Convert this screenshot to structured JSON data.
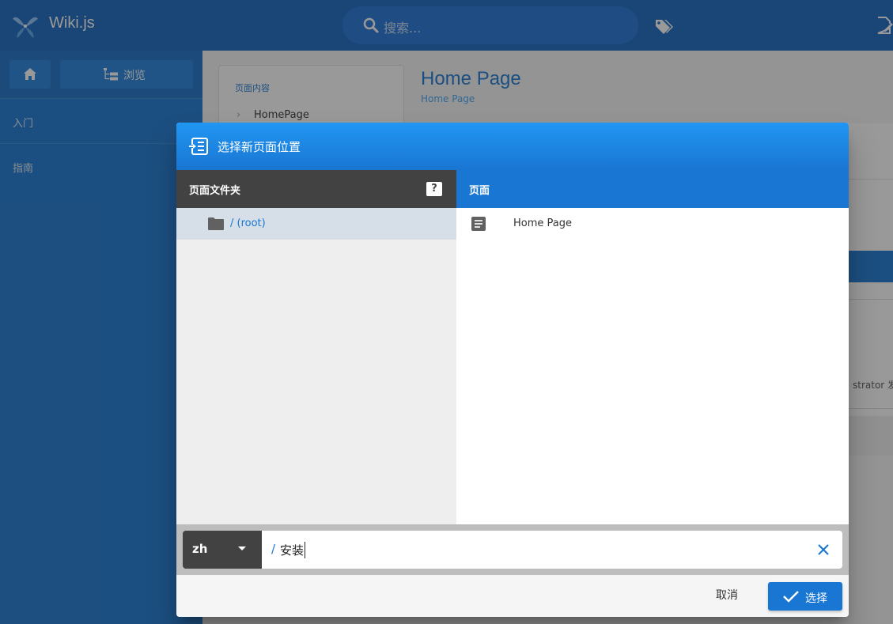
{
  "app": {
    "title": "Wiki.js"
  },
  "header": {
    "search_placeholder": "搜索..."
  },
  "sidebar": {
    "browse_label": "浏览",
    "items": [
      {
        "label": "入门"
      },
      {
        "label": "指南"
      }
    ]
  },
  "page": {
    "toc_title": "页面内容",
    "toc_items": [
      "HomePage"
    ],
    "title": "Home Page",
    "subtitle": "Home Page",
    "author_fragment": "strator 发布"
  },
  "dialog": {
    "title": "选择新页面位置",
    "folders_header": "页面文件夹",
    "help_label": "?",
    "folders": [
      {
        "label": "/ (root)"
      }
    ],
    "pages_header": "页面",
    "pages": [
      {
        "label": "Home Page"
      }
    ],
    "locale": {
      "value": "zh"
    },
    "path": {
      "prefix": "/",
      "value": "安装"
    },
    "cancel_label": "取消",
    "select_label": "选择"
  },
  "colors": {
    "primary": "#1976d2",
    "dark_header": "#424242",
    "selected_folder_bg": "#d6dfe8"
  }
}
